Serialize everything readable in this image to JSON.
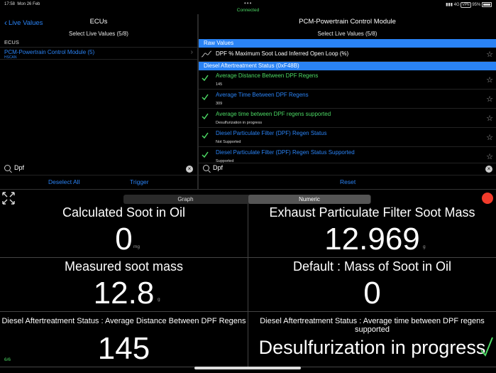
{
  "status_bar": {
    "time": "17:58",
    "date": "Mon 26 Feb",
    "connection": "Connected",
    "network": "4G",
    "battery": "95%"
  },
  "left_panel": {
    "back_label": "Live Values",
    "title": "ECUs",
    "subtitle": "Select Live Values (5/8)",
    "section_label": "ECUS",
    "ecu_item": {
      "name": "PCM-Powertrain Control Module (5)",
      "protocol": "HSCAN"
    },
    "search_value": "Dpf",
    "buttons": {
      "deselect": "Deselect All",
      "trigger": "Trigger"
    }
  },
  "right_panel": {
    "title": "PCM-Powertrain Control Module",
    "subtitle": "Select Live Values (5/8)",
    "raw_section": "Raw Values",
    "raw_item": "DPF % Maximum Soot Load Inferred Open Loop (%)",
    "status_section": "Diesel Aftertreatment Status (0xF48B)",
    "items": [
      {
        "title": "Average Distance Between DPF Regens",
        "value": "145",
        "color": "#4cd964"
      },
      {
        "title": "Average Time Between DPF Regens",
        "value": "309",
        "color": "#2a83f5"
      },
      {
        "title": "Average time between DPF regens supported",
        "value": "Desulfurization in progress",
        "color": "#4cd964"
      },
      {
        "title": "Diesel Particulate Filter (DPF) Regen Status",
        "value": "Not Supported",
        "color": "#2a83f5"
      },
      {
        "title": "Diesel Particulate Filter (DPF) Regen Status Supported",
        "value": "Supported",
        "color": "#2a83f5"
      }
    ],
    "search_value": "Dpf",
    "reset": "Reset"
  },
  "view_tabs": {
    "graph": "Graph",
    "numeric": "Numeric"
  },
  "grid": [
    {
      "label": "Calculated Soot in Oil",
      "value": "0",
      "unit": "mg"
    },
    {
      "label": "Exhaust Particulate Filter Soot Mass",
      "value": "12.969",
      "unit": "g"
    },
    {
      "label": "Measured soot mass",
      "value": "12.8",
      "unit": "g"
    },
    {
      "label": "Default : Mass of Soot in Oil",
      "value": "0",
      "unit": ""
    },
    {
      "label": "Diesel Aftertreatment Status : Average Distance Between DPF Regens",
      "value": "145",
      "unit": ""
    },
    {
      "label": "Diesel Aftertreatment Status : Average time between DPF regens supported",
      "value": "Desulfurization in progress",
      "unit": ""
    }
  ],
  "pager": "6/6",
  "colors": {
    "accent_blue": "#2a83f5",
    "accent_green": "#4cd964",
    "record_red": "#f23b2b"
  },
  "icons": [
    "back-chevron-icon",
    "chevron-right-icon",
    "search-icon",
    "clear-icon",
    "sine-wave-icon",
    "checkmark-icon",
    "star-icon",
    "expand-icon",
    "record-icon",
    "wifi-icon",
    "battery-icon"
  ]
}
